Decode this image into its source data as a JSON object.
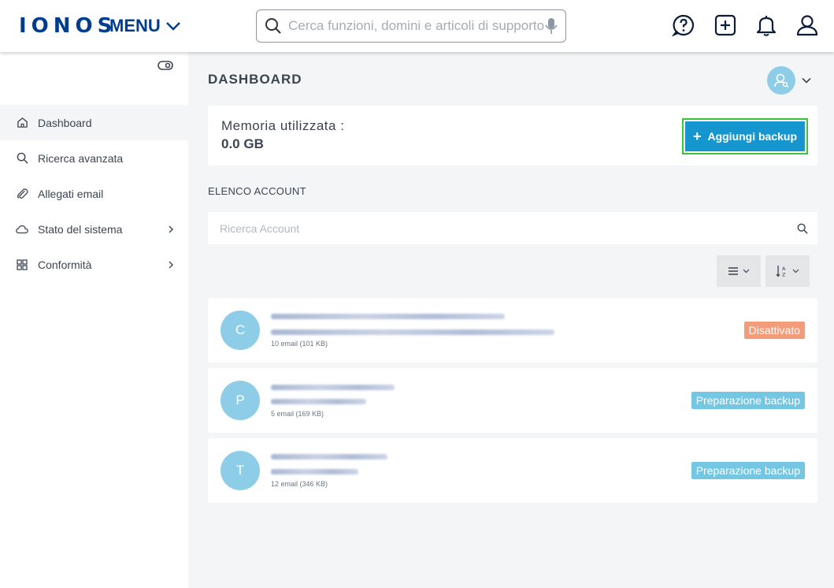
{
  "header": {
    "logo": "IONOS",
    "menu_label": "MENU",
    "search_placeholder": "Cerca funzioni, domini e articoli di supporto"
  },
  "sidebar": {
    "items": [
      {
        "label": "Dashboard",
        "icon": "home-icon",
        "active": true
      },
      {
        "label": "Ricerca avanzata",
        "icon": "search-icon"
      },
      {
        "label": "Allegati email",
        "icon": "paperclip-icon"
      },
      {
        "label": "Stato del sistema",
        "icon": "cloud-icon",
        "has_children": true
      },
      {
        "label": "Conformità",
        "icon": "grid-icon",
        "has_children": true
      }
    ]
  },
  "main": {
    "title": "DASHBOARD",
    "memory": {
      "label": "Memoria utilizzata :",
      "value": "0.0 GB"
    },
    "add_backup_label": "Aggiungi backup",
    "accounts_title": "ELENCO ACCOUNT",
    "account_search_placeholder": "Ricerca Account",
    "accounts": [
      {
        "initial": "C",
        "meta": "10 email (101 KB)",
        "status": "Disattivato",
        "status_color": "#f49b79"
      },
      {
        "initial": "P",
        "meta": "5 email (169 KB)",
        "status": "Preparazione backup",
        "status_color": "#74c7e3"
      },
      {
        "initial": "T",
        "meta": "12 email (346 KB)",
        "status": "Preparazione backup",
        "status_color": "#74c7e3"
      }
    ]
  },
  "colors": {
    "brand": "#003d8f",
    "primary_button": "#1596ce",
    "highlight_border": "#3ac43a",
    "avatar": "#8ecde8"
  }
}
